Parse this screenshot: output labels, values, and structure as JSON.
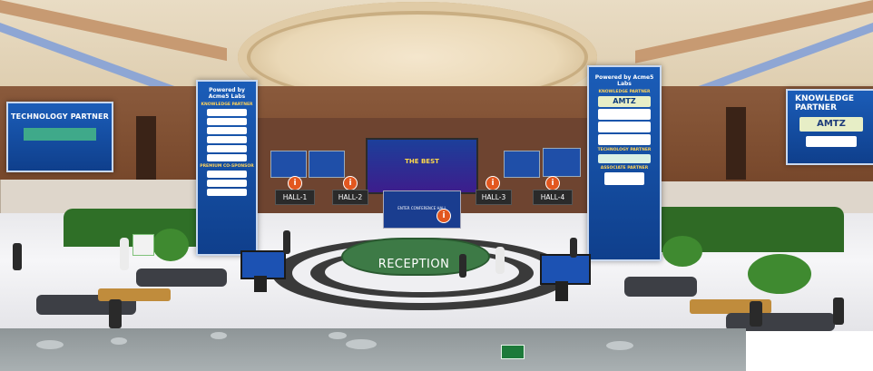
{
  "hall": {
    "tech_partner_caption": "TECHNOLOGY PARTNER",
    "knowledge_partner_caption": "KNOWLEDGE PARTNER",
    "knowledge_partner_logo": "AMTZ",
    "left_tower": {
      "brand": "Powered by Acme5 Labs",
      "sections": [
        "KNOWLEDGE PARTNER",
        "PREMIUM CO-SPONSOR"
      ]
    },
    "right_tower": {
      "brand": "Powered by Acme5 Labs",
      "logo_top": "AMTZ",
      "sections": [
        "KNOWLEDGE PARTNER",
        "TECHNOLOGY PARTNER",
        "ASSOCIATE PARTNER"
      ]
    },
    "center_screen_text": "THE BEST",
    "conference_panel_text": "ENTER CONFERENCE HALL",
    "halls": [
      "HALL-1",
      "HALL-2",
      "HALL-3",
      "HALL-4"
    ],
    "info_icon_glyph": "i",
    "reception_label": "RECEPTION"
  },
  "colors": {
    "banner_blue": "#1b5db8",
    "hedge_green": "#2f6f27",
    "reception_green": "#3d7a46",
    "info_orange": "#e2571f"
  }
}
